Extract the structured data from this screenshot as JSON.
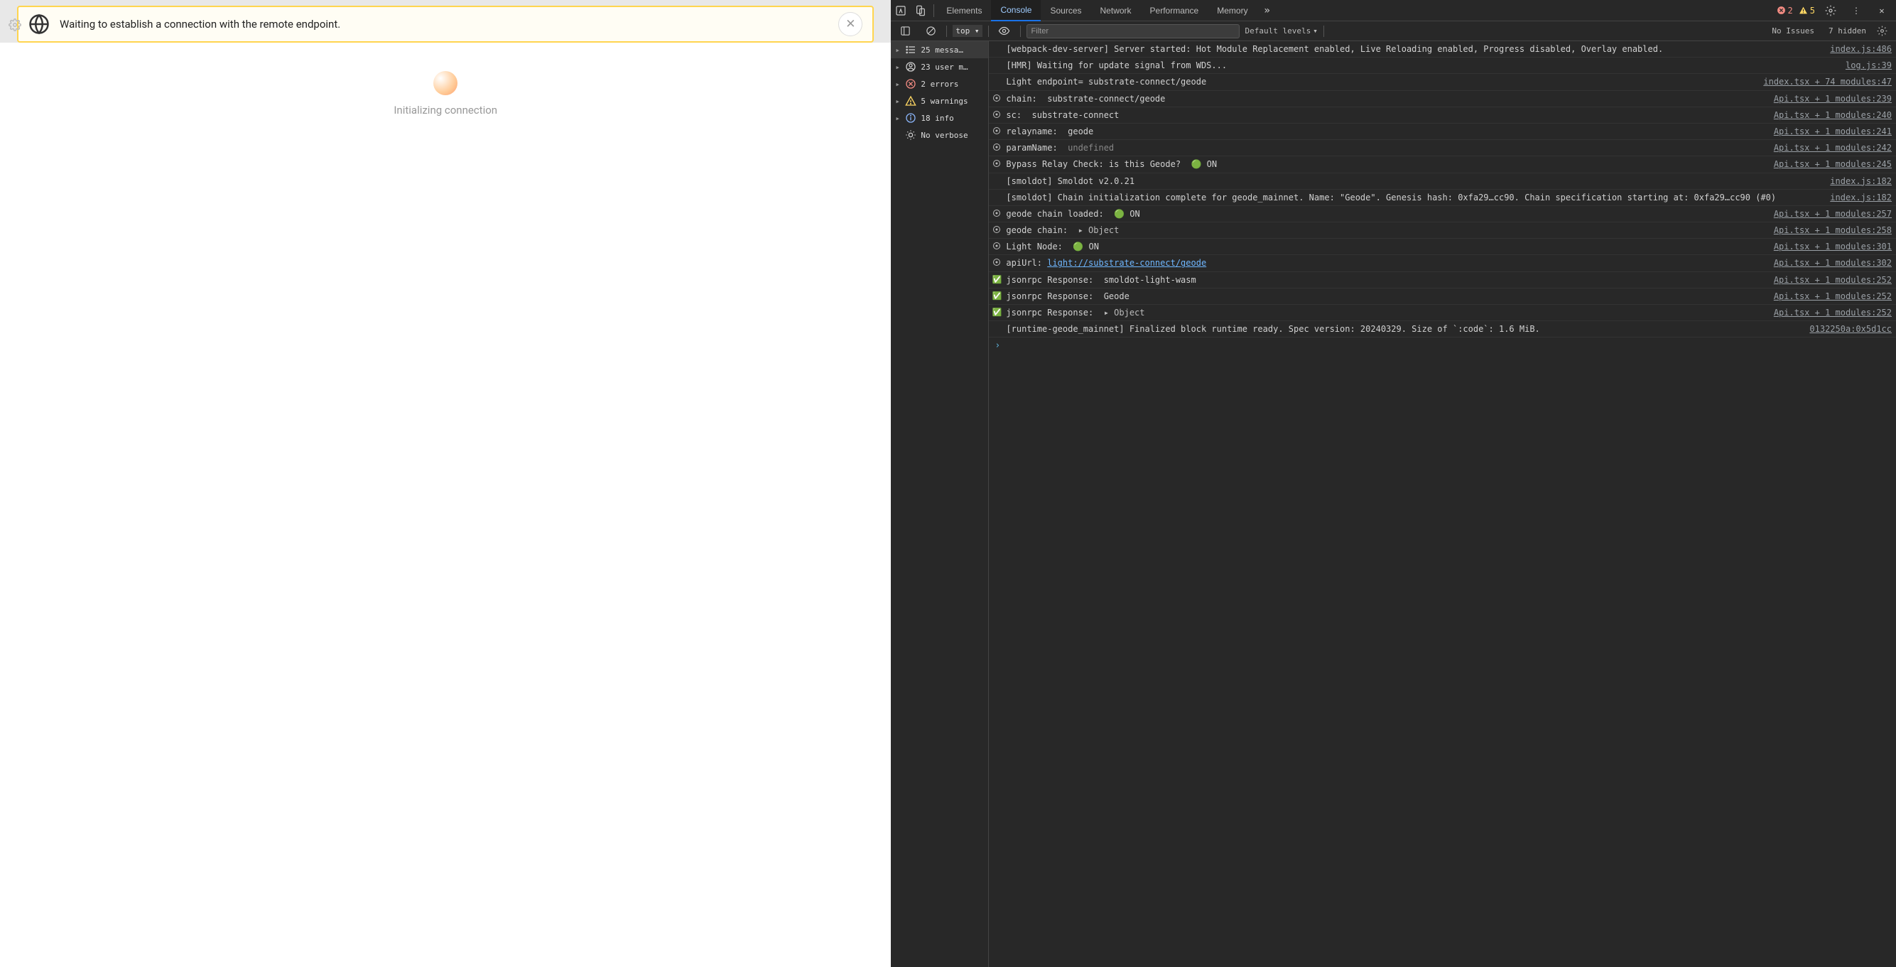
{
  "app": {
    "notice_text": "Waiting to establish a connection with the remote endpoint.",
    "init_text": "Initializing connection"
  },
  "devtools": {
    "tabs": [
      "Elements",
      "Console",
      "Sources",
      "Network",
      "Performance",
      "Memory"
    ],
    "active_tab": "Console",
    "error_count": "2",
    "warn_count": "5",
    "toolbar": {
      "context": "top",
      "filter_placeholder": "Filter",
      "levels": "Default levels",
      "issues": "No Issues",
      "hidden": "7 hidden"
    },
    "sidebar": [
      {
        "icon": "list",
        "label": "25 messa…"
      },
      {
        "icon": "user",
        "label": "23 user m…"
      },
      {
        "icon": "error",
        "label": "2 errors"
      },
      {
        "icon": "warn",
        "label": "5 warnings"
      },
      {
        "icon": "info",
        "label": "18 info"
      },
      {
        "icon": "verbose",
        "label": "No verbose"
      }
    ],
    "logs": [
      {
        "lvl": "none",
        "msg": "[webpack-dev-server] Server started: Hot Module Replacement enabled, Live Reloading enabled, Progress disabled, Overlay enabled.",
        "src": "index.js:486"
      },
      {
        "lvl": "none",
        "msg": "[HMR] Waiting for update signal from WDS...",
        "src": "log.js:39"
      },
      {
        "lvl": "none",
        "msg": "Light endpoint= substrate-connect/geode",
        "src": "index.tsx + 74 modules:47"
      },
      {
        "lvl": "info",
        "msg": "chain:  substrate-connect/geode",
        "src": "Api.tsx + 1 modules:239"
      },
      {
        "lvl": "info",
        "msg": "sc:  substrate-connect",
        "src": "Api.tsx + 1 modules:240"
      },
      {
        "lvl": "info",
        "msg": "relayname:  geode",
        "src": "Api.tsx + 1 modules:241"
      },
      {
        "lvl": "info",
        "msg_html": "paramName:  <span class='undef'>undefined</span>",
        "src": "Api.tsx + 1 modules:242"
      },
      {
        "lvl": "info",
        "msg": "Bypass Relay Check: is this Geode?  🟢 ON",
        "src": "Api.tsx + 1 modules:245"
      },
      {
        "lvl": "none",
        "msg": "[smoldot] Smoldot v2.0.21",
        "src": "index.js:182"
      },
      {
        "lvl": "none",
        "msg": "[smoldot] Chain initialization complete for geode_mainnet. Name: \"Geode\". Genesis hash: 0xfa29…cc90. Chain specification starting at: 0xfa29…cc90 (#0)",
        "src": "index.js:182"
      },
      {
        "lvl": "info",
        "msg": "geode chain loaded:  🟢 ON",
        "src": "Api.tsx + 1 modules:257"
      },
      {
        "lvl": "info",
        "msg_html": "geode chain:  <span class='obj-toggle'>▸ Object</span>",
        "src": "Api.tsx + 1 modules:258"
      },
      {
        "lvl": "info",
        "msg": "Light Node:  🟢 ON",
        "src": "Api.tsx + 1 modules:301"
      },
      {
        "lvl": "info",
        "msg_html": "apiUrl: <span class='link'>light://substrate-connect/geode</span>",
        "src": "Api.tsx + 1 modules:302"
      },
      {
        "lvl": "ok",
        "msg": "jsonrpc Response:  smoldot-light-wasm",
        "src": "Api.tsx + 1 modules:252"
      },
      {
        "lvl": "ok",
        "msg": "jsonrpc Response:  Geode",
        "src": "Api.tsx + 1 modules:252"
      },
      {
        "lvl": "ok",
        "msg_html": "jsonrpc Response:  <span class='obj-toggle'>▸ Object</span>",
        "src": "Api.tsx + 1 modules:252"
      },
      {
        "lvl": "none",
        "msg": "[runtime-geode_mainnet] Finalized block runtime ready. Spec version: 20240329. Size of `:code`: 1.6 MiB.",
        "src": "0132250a:0x5d1cc"
      }
    ]
  }
}
